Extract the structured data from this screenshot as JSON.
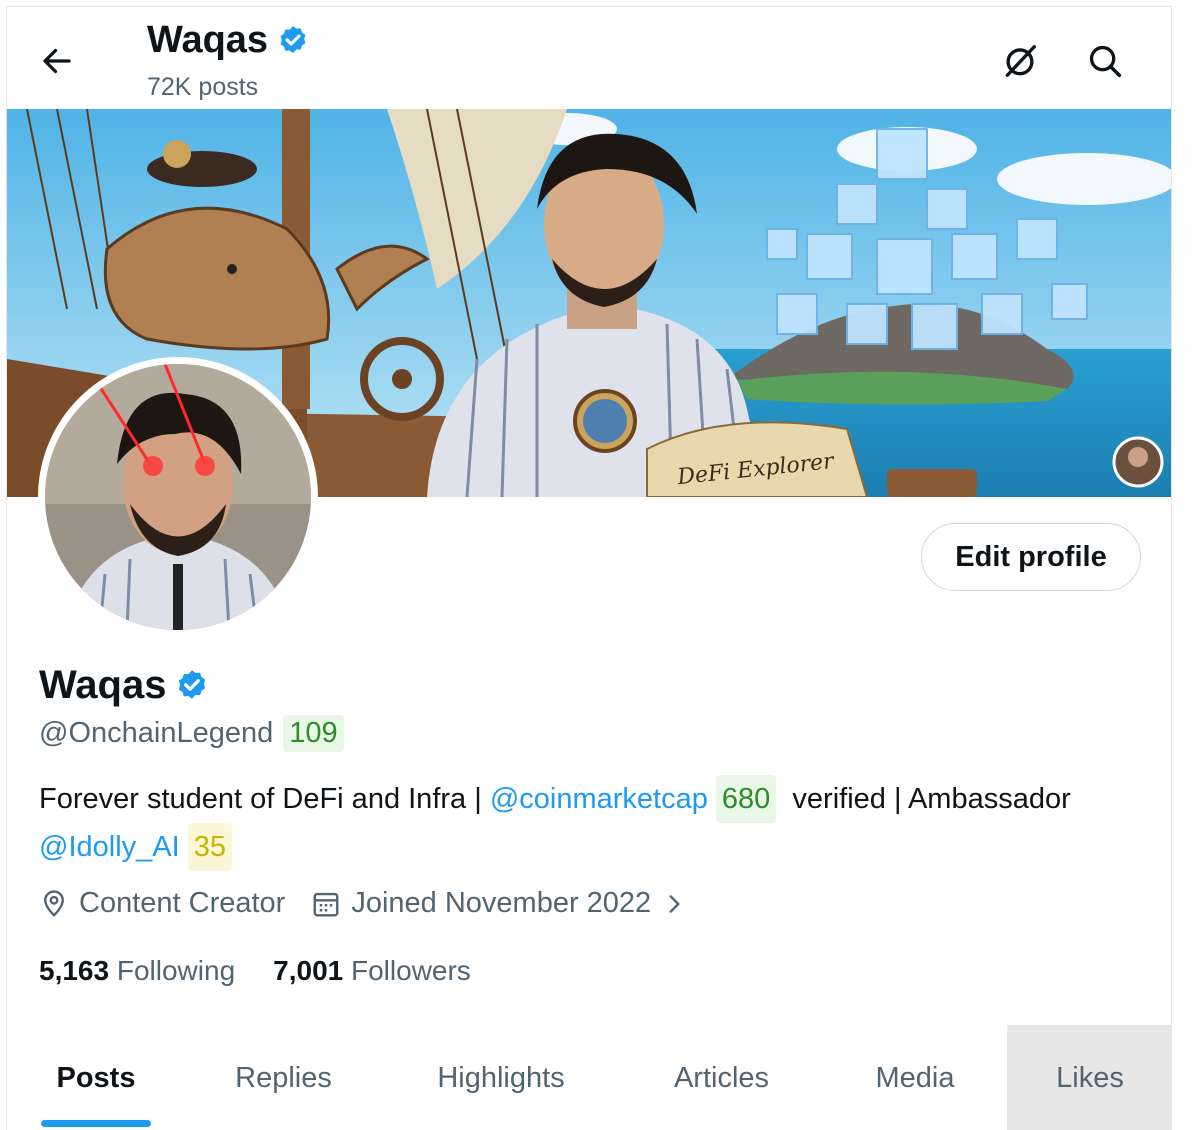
{
  "header": {
    "name": "Waqas",
    "posts_count": "72K posts",
    "icons": [
      "back-arrow-icon",
      "grok-icon",
      "search-icon"
    ]
  },
  "banner": {
    "map_text": "DeFi Explorer"
  },
  "profile": {
    "name": "Waqas",
    "handle": "@OnchainLegend",
    "handle_badge": "109",
    "edit_label": "Edit profile",
    "bio_prefix": "Forever student of DeFi and Infra |",
    "bio_link1": "@coinmarketcap",
    "bio_link1_badge": "680",
    "bio_middle": "verified | Ambassador",
    "bio_link2": "@Idolly_AI",
    "bio_link2_badge": "35",
    "location": "Content Creator",
    "joined": "Joined November 2022",
    "following_count": "5,163",
    "following_label": "Following",
    "followers_count": "7,001",
    "followers_label": "Followers"
  },
  "colors": {
    "accent": "#1d9bf0",
    "verified": "#1d9bf0",
    "badge_green": "#2e8b2e",
    "badge_yellow": "#c5b500"
  },
  "tabs": [
    {
      "label": "Posts",
      "active": true
    },
    {
      "label": "Replies",
      "active": false
    },
    {
      "label": "Highlights",
      "active": false
    },
    {
      "label": "Articles",
      "active": false
    },
    {
      "label": "Media",
      "active": false
    },
    {
      "label": "Likes",
      "active": false
    }
  ]
}
